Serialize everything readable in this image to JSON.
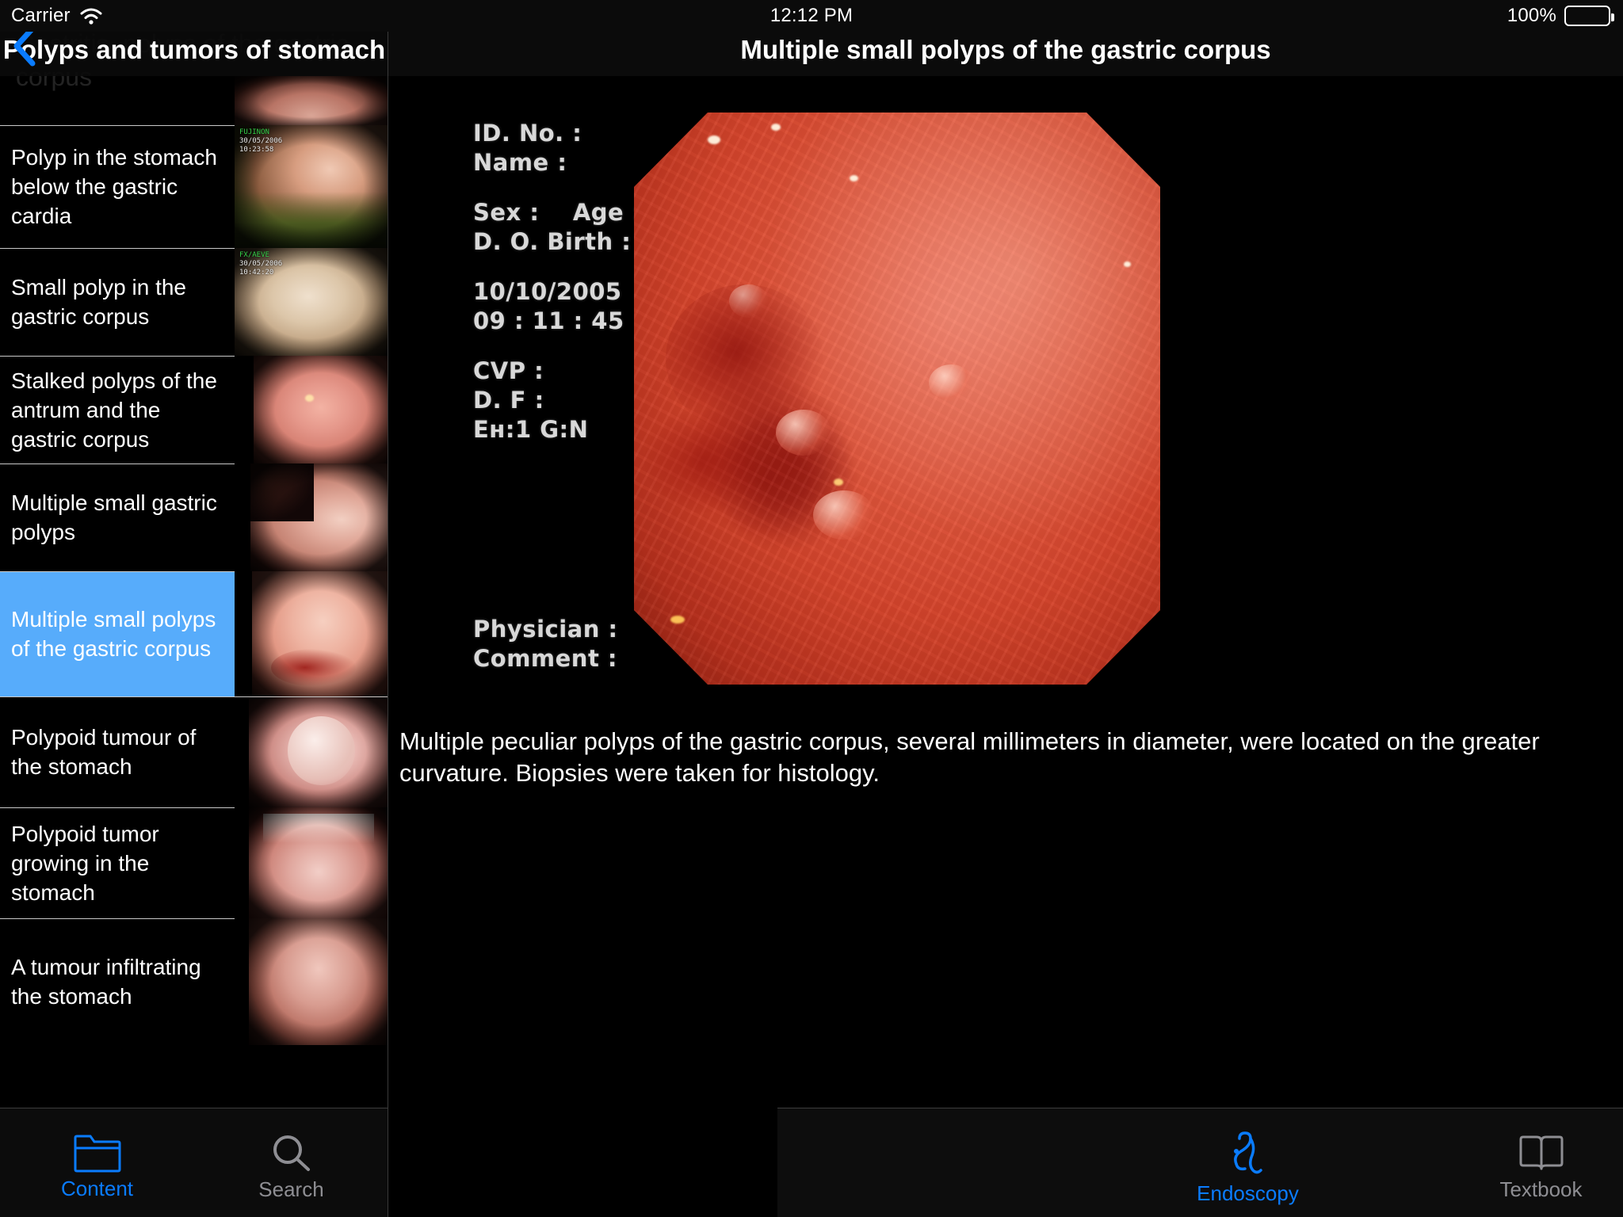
{
  "status_bar": {
    "carrier": "Carrier",
    "wifi_icon": "wifi-icon",
    "time": "12:12 PM",
    "battery_percent": "100%",
    "battery_icon": "battery-full-icon"
  },
  "master": {
    "back_icon": "back-chevron-icon",
    "title": "Polyps and tumors of stomach",
    "ghost_title": "Gastritis, polyps of the gastric corpus",
    "partial_bottom_row": "A tumour infiltrating the stomach",
    "items": [
      {
        "label": "Polyp in the stomach below the gastric cardia",
        "selected": false,
        "thumb_overlay_1": "FUJINON",
        "thumb_overlay_2": "30/05/2006",
        "thumb_overlay_3": "10:23:58"
      },
      {
        "label": "Small polyp in the gastric corpus",
        "selected": false,
        "thumb_overlay_1": "FX/AEVE",
        "thumb_overlay_2": "30/05/2006",
        "thumb_overlay_3": "10:42:20"
      },
      {
        "label": "Stalked polyps of the antrum and the gastric corpus",
        "selected": false,
        "thumb_overlay_1": "",
        "thumb_overlay_2": "",
        "thumb_overlay_3": ""
      },
      {
        "label": "Multiple small gastric polyps",
        "selected": false,
        "thumb_overlay_1": "",
        "thumb_overlay_2": "",
        "thumb_overlay_3": ""
      },
      {
        "label": "Multiple small polyps of the gastric corpus",
        "selected": true,
        "thumb_overlay_1": "",
        "thumb_overlay_2": "",
        "thumb_overlay_3": ""
      },
      {
        "label": "Polypoid tumour of the stomach",
        "selected": false,
        "thumb_overlay_1": "",
        "thumb_overlay_2": "",
        "thumb_overlay_3": ""
      },
      {
        "label": "Polypoid tumor growing in the stomach",
        "selected": false,
        "thumb_overlay_1": "",
        "thumb_overlay_2": "",
        "thumb_overlay_3": ""
      }
    ]
  },
  "detail": {
    "title": "Multiple small polyps of the gastric corpus",
    "image_overlay": {
      "id_no": "ID. No. :",
      "name": "Name :",
      "sex": "Sex :",
      "age": "Age :",
      "dob": "D. O. Birth :",
      "date": "10/10/2005",
      "time": "09 : 11 : 45",
      "cvp": "CVP :",
      "df": "D. F :",
      "eh_g": "Eн:1 G:N",
      "physician": "Physician :",
      "comment": "Comment :"
    },
    "caption": "Multiple peculiar polyps of the gastric corpus, several millimeters in diameter, were located on the greater curvature. Biopsies were taken for histology."
  },
  "tab_bars": {
    "left": [
      {
        "label": "Content",
        "icon": "folder-icon",
        "active": true
      },
      {
        "label": "Search",
        "icon": "search-icon",
        "active": false
      }
    ],
    "right": [
      {
        "label": "Endoscopy",
        "icon": "endoscope-icon",
        "active": true
      },
      {
        "label": "Textbook",
        "icon": "open-book-icon",
        "active": false
      }
    ]
  },
  "colors": {
    "accent_blue": "#0a7cff",
    "selection_blue": "#57acfb",
    "inactive_gray": "#8e8e93",
    "background": "#000000",
    "nav_background": "#0b0b0b"
  }
}
